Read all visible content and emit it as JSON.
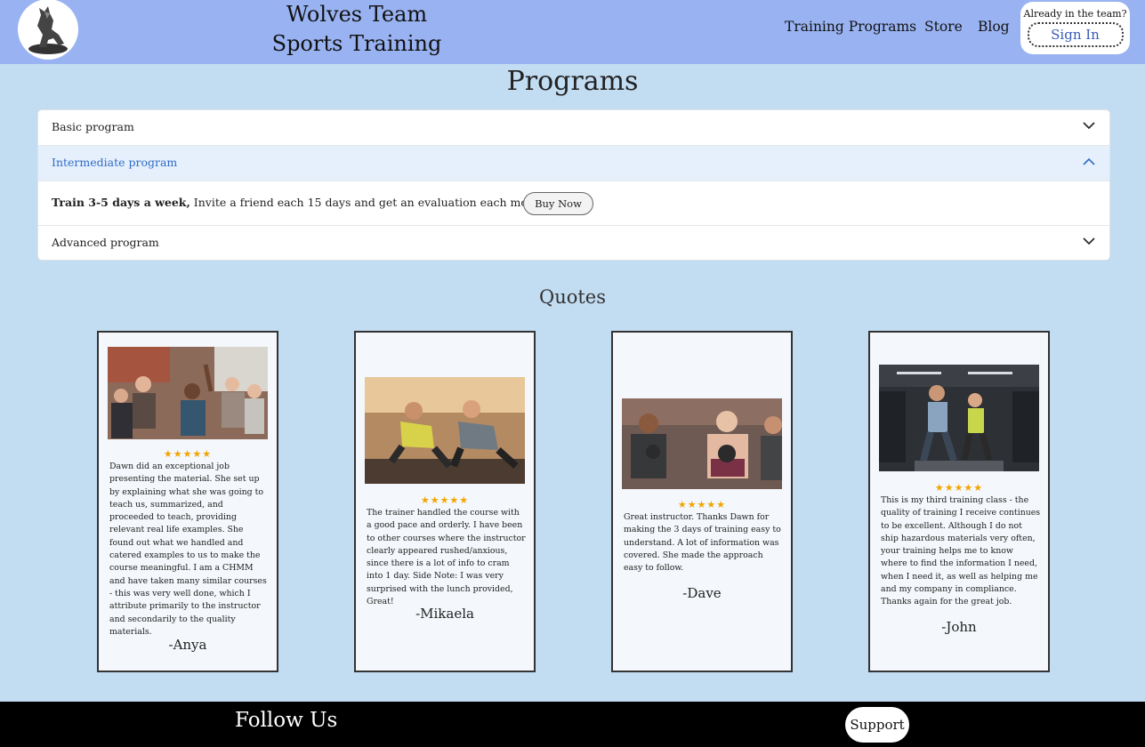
{
  "header": {
    "brand_line1": "Wolves Team",
    "brand_line2": "Sports Training",
    "nav": [
      "Training Programs",
      "Store",
      "Blog"
    ],
    "signin_note": "Already in the team?",
    "signin_label": "Sign In"
  },
  "programs": {
    "title": "Programs",
    "items": [
      {
        "label": "Basic program",
        "expanded": false
      },
      {
        "label": "Intermediate program",
        "expanded": true,
        "details_bold": "Train 3-5 days a week,",
        "details_text": " Invite a friend each 15 days and get an evaluation each month",
        "buy_label": "Buy Now"
      },
      {
        "label": "Advanced program",
        "expanded": false
      }
    ]
  },
  "quotes": {
    "title": "Quotes",
    "items": [
      {
        "stars": "★★★★★",
        "text": "Dawn did an exceptional job presenting the material. She set up by explaining what she was going to teach us, summarized, and proceeded to teach, providing relevant real life examples. She found out what we handled and catered examples to us to make the course meaningful. I am a CHMM and have taken many similar courses - this was very well done, which I attribute primarily to the instructor and secondarily to the quality materials.",
        "author": "-Anya",
        "photo": "photo-audience"
      },
      {
        "stars": "★★★★★",
        "text": "The trainer handled the course with a good pace and orderly. I have been to other courses where the instructor clearly appeared rushed/anxious, since there is a lot of info to cram into 1 day. Side Note: I was very surprised with the lunch provided, Great!",
        "author": "-Mikaela",
        "photo": "photo-pushups"
      },
      {
        "stars": "★★★★★",
        "text": "Great instructor. Thanks Dawn for making the 3 days of training easy to understand. A lot of information was covered. She made the approach easy to follow.",
        "author": "-Dave",
        "photo": "photo-kettlebell"
      },
      {
        "stars": "★★★★★",
        "text": "This is my third training class - the quality of training I receive continues to be excellent. Although I do not ship hazardous materials very often, your training helps me to know where to find the information I need, when I need it, as well as helping me and my company in compliance. Thanks again for the great job.",
        "author": "-John",
        "photo": "photo-gym"
      }
    ]
  },
  "footer": {
    "follow": "Follow Us",
    "support_label": "Support"
  },
  "colors": {
    "header_bg": "#99b3f2",
    "page_bg": "#c2dcf2",
    "accent_link": "#2f6bc9",
    "star": "#f2a500",
    "footer_bg": "#000000"
  }
}
